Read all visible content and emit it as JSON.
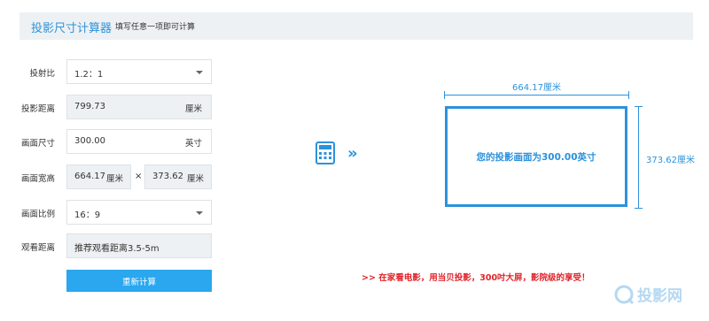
{
  "header": {
    "title": "投影尺寸计算器",
    "subtitle": "填写任意一项即可计算"
  },
  "form": {
    "throw_ratio": {
      "label": "投射比",
      "value": "1.2：1"
    },
    "distance": {
      "label": "投影距离",
      "value": "799.73",
      "unit": "厘米"
    },
    "screen_size": {
      "label": "画面尺寸",
      "value": "300.00",
      "unit": "英寸"
    },
    "dimensions": {
      "label": "画面宽高",
      "width": "664.17",
      "width_unit": "厘米",
      "times": "×",
      "height": "373.62",
      "height_unit": "厘米"
    },
    "aspect": {
      "label": "画面比例",
      "value": "16：9"
    },
    "viewing": {
      "label": "观看距离",
      "value": "推荐观看距离3.5-5m"
    },
    "recalc_label": "重新计算"
  },
  "preview": {
    "width_label": "664.17厘米",
    "height_label": "373.62厘米",
    "screen_text": "您的投影画面为300.00英寸",
    "arrow": "»",
    "accent": "#2c92dc"
  },
  "promo": ">> 在家看电影，用当贝投影，300吋大屏，影院级的享受！",
  "watermark": {
    "text": "投影网"
  },
  "icons": {
    "calculator": "calculator-icon",
    "caret": "chevron-down-icon"
  }
}
